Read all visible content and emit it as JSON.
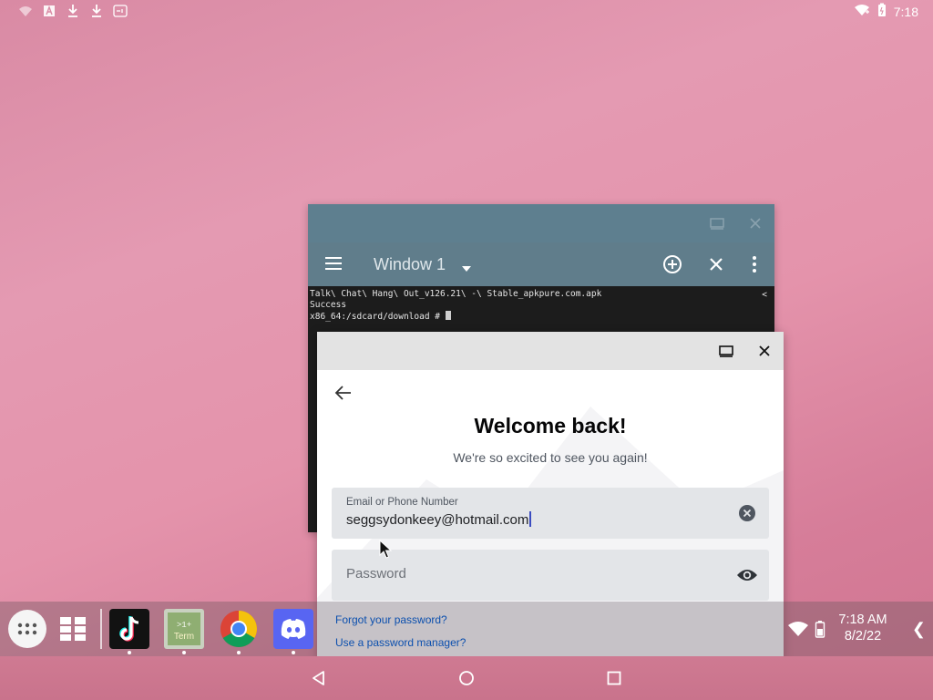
{
  "status_bar": {
    "time": "7:18",
    "left_icons": [
      "cast-icon",
      "a-badge-icon",
      "download-icon",
      "download-icon",
      "app-notification-icon"
    ]
  },
  "terminal": {
    "window_title": "Window 1",
    "lines": [
      "Talk\\ Chat\\ Hang\\ Out_v126.21\\ -\\ Stable_apkpure.com.apk",
      "Success",
      "x86_64:/sdcard/download # "
    ],
    "scroll_mark": "<"
  },
  "discord": {
    "title": "Welcome back!",
    "subtitle": "We're so excited to see you again!",
    "email_label": "Email or Phone Number",
    "email_value": "seggsydonkeey@hotmail.com",
    "password_placeholder": "Password",
    "forgot_link": "Forgot your password?",
    "manager_link": "Use a password manager?",
    "colors": {
      "link": "#0b4fae",
      "field": "#e3e5e8"
    }
  },
  "taskbar": {
    "apps": [
      {
        "name": "TikTok"
      },
      {
        "name": "Termux",
        "label_top": ">1+",
        "label_bottom": "Term"
      },
      {
        "name": "Chrome"
      },
      {
        "name": "Discord"
      }
    ],
    "time": "7:18 AM",
    "date": "8/2/22",
    "chevron": "❮"
  }
}
